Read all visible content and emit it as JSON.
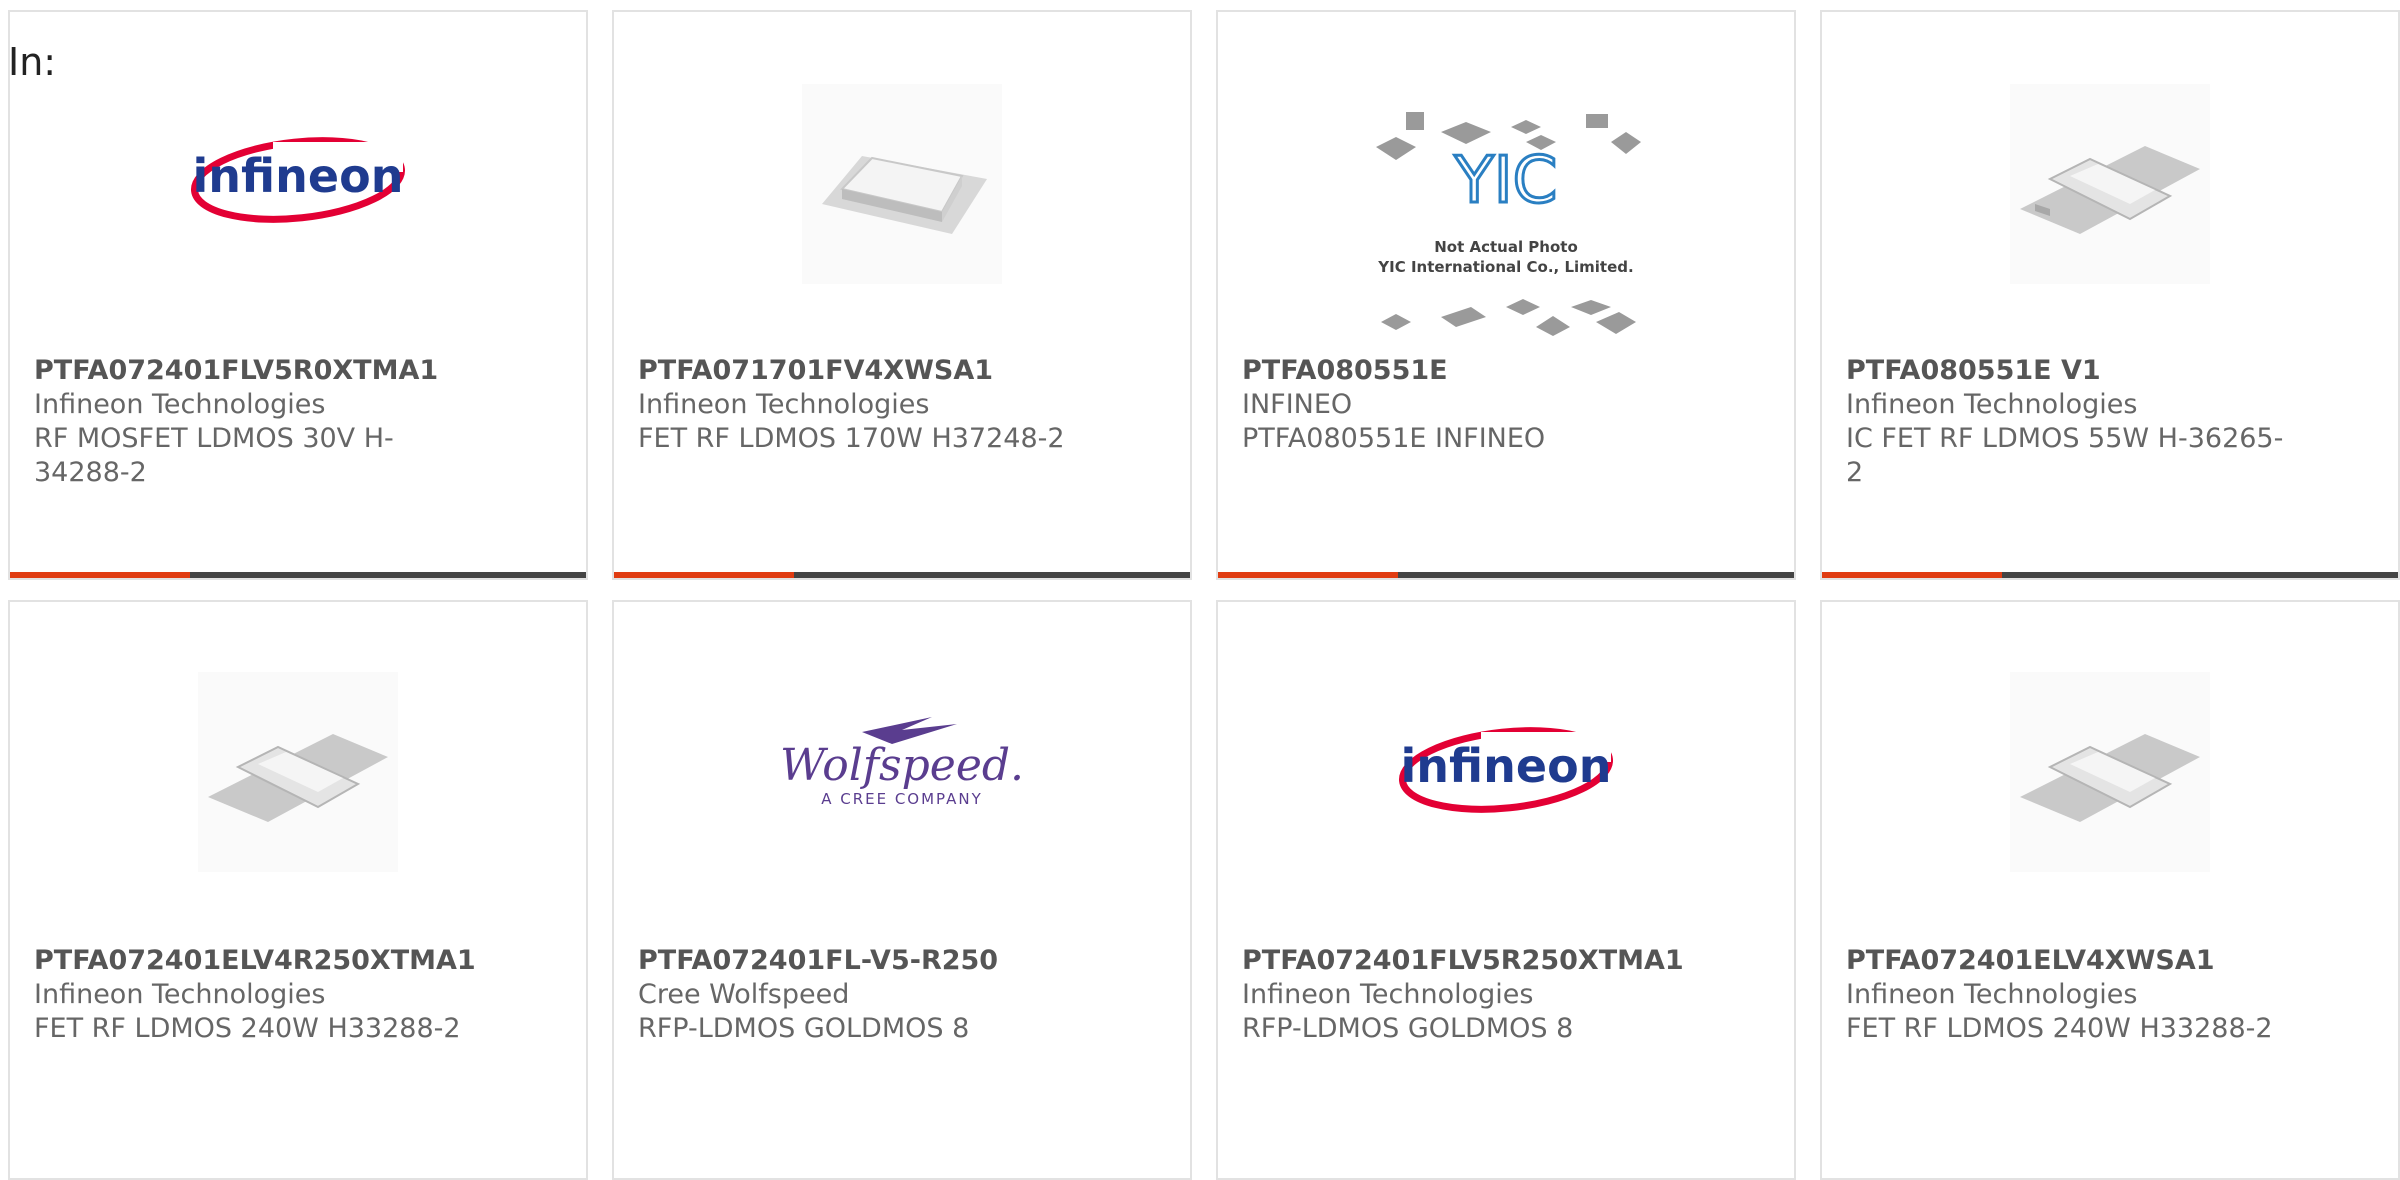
{
  "filter": {
    "label": "In:"
  },
  "colors": {
    "accent": "#e03c12",
    "bar": "#444444",
    "infineon_blue": "#1f3b8f",
    "infineon_red": "#e30034",
    "wolfspeed": "#5a3d8f"
  },
  "products": [
    {
      "part_number": "PTFA072401FLV5R0XTMA1",
      "manufacturer": "Infineon Technologies",
      "description": "RF MOSFET LDMOS 30V H-34288-2",
      "image": "infineon-logo"
    },
    {
      "part_number": "PTFA071701FV4XWSA1",
      "manufacturer": "Infineon Technologies",
      "description": "FET RF LDMOS 170W H37248-2",
      "image": "flat-package-photo"
    },
    {
      "part_number": "PTFA080551E",
      "manufacturer": "INFINEO",
      "description": "PTFA080551E INFINEO",
      "image": "yic-placeholder",
      "placeholder_lines": [
        "Not Actual Photo",
        "YIC International Co., Limited."
      ],
      "placeholder_logo": "YIC"
    },
    {
      "part_number": "PTFA080551E V1",
      "manufacturer": "Infineon Technologies",
      "description": "IC FET RF LDMOS 55W H-36265-2",
      "image": "flange-package-photo"
    },
    {
      "part_number": "PTFA072401ELV4R250XTMA1",
      "manufacturer": "Infineon Technologies",
      "description": "FET RF LDMOS 240W H33288-2",
      "image": "flange-package-photo"
    },
    {
      "part_number": "PTFA072401FL-V5-R250",
      "manufacturer": "Cree Wolfspeed",
      "description": "RFP-LDMOS GOLDMOS 8",
      "image": "wolfspeed-logo",
      "logo_text": "Wolfspeed.",
      "logo_sub": "A CREE COMPANY"
    },
    {
      "part_number": "PTFA072401FLV5R250XTMA1",
      "manufacturer": "Infineon Technologies",
      "description": "RFP-LDMOS GOLDMOS 8",
      "image": "infineon-logo"
    },
    {
      "part_number": "PTFA072401ELV4XWSA1",
      "manufacturer": "Infineon Technologies",
      "description": "FET RF LDMOS 240W H33288-2",
      "image": "flange-package-photo"
    }
  ],
  "brand_logo_text": "infineon"
}
